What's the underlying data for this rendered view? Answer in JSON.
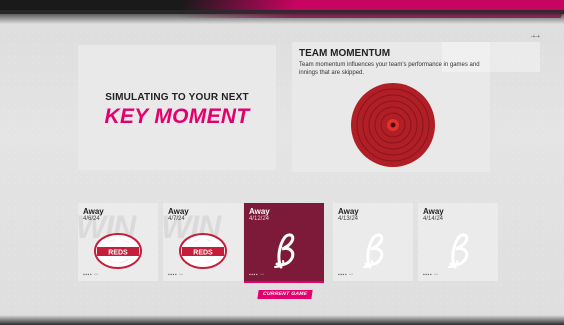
{
  "header": {
    "corner_mark": "-+-+"
  },
  "sim_panel": {
    "subtitle": "SIMULATING TO YOUR NEXT",
    "title": "KEY MOMENT"
  },
  "momentum_panel": {
    "title": "TEAM MOMENTUM",
    "description": "Team momentum influences your team's performance in games and innings that are skipped."
  },
  "games": [
    {
      "location": "Away",
      "date": "4/6/24",
      "logo": "reds-logo",
      "dashes": "▪▪▪▪ ▫▫",
      "current": false
    },
    {
      "location": "Away",
      "date": "4/7/24",
      "logo": "reds-logo",
      "dashes": "▪▪▪▪ ▫▫",
      "current": false
    },
    {
      "location": "Away",
      "date": "4/12/24",
      "logo": "script-b-logo",
      "dashes": "▪▪▪▪ ▫▫",
      "current": true
    },
    {
      "location": "Away",
      "date": "4/13/24",
      "logo": "script-b-logo",
      "dashes": "▪▪▪▪ ▫▫",
      "current": false
    },
    {
      "location": "Away",
      "date": "4/14/24",
      "logo": "script-b-logo",
      "dashes": "▪▪▪▪ ▫▫",
      "current": false
    }
  ],
  "card_watermark": "WIN",
  "current_game_label": "CURRENT GAME",
  "colors": {
    "accent_pink": "#e3006d",
    "current_card": "#7d1a3a",
    "target_red": "#b01e26"
  }
}
